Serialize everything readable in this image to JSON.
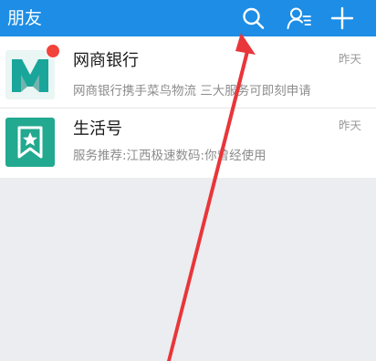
{
  "header": {
    "title": "朋友",
    "icons": [
      "search-icon",
      "contacts-icon",
      "plus-icon"
    ],
    "background": "#1d8de5"
  },
  "conversations": [
    {
      "name": "网商银行",
      "preview": "网商银行携手菜鸟物流 三大服务可即刻申请",
      "time": "昨天",
      "unread_badge": true,
      "avatar_icon": "mybank-logo",
      "avatar_color": "#1aa59b"
    },
    {
      "name": "生活号",
      "preview": "服务推荐:江西极速数码:你曾经使用",
      "time": "昨天",
      "unread_badge": false,
      "avatar_icon": "bookmark-star-icon",
      "avatar_color": "#22a98f"
    }
  ],
  "annotation_arrow_color": "#e8363a"
}
